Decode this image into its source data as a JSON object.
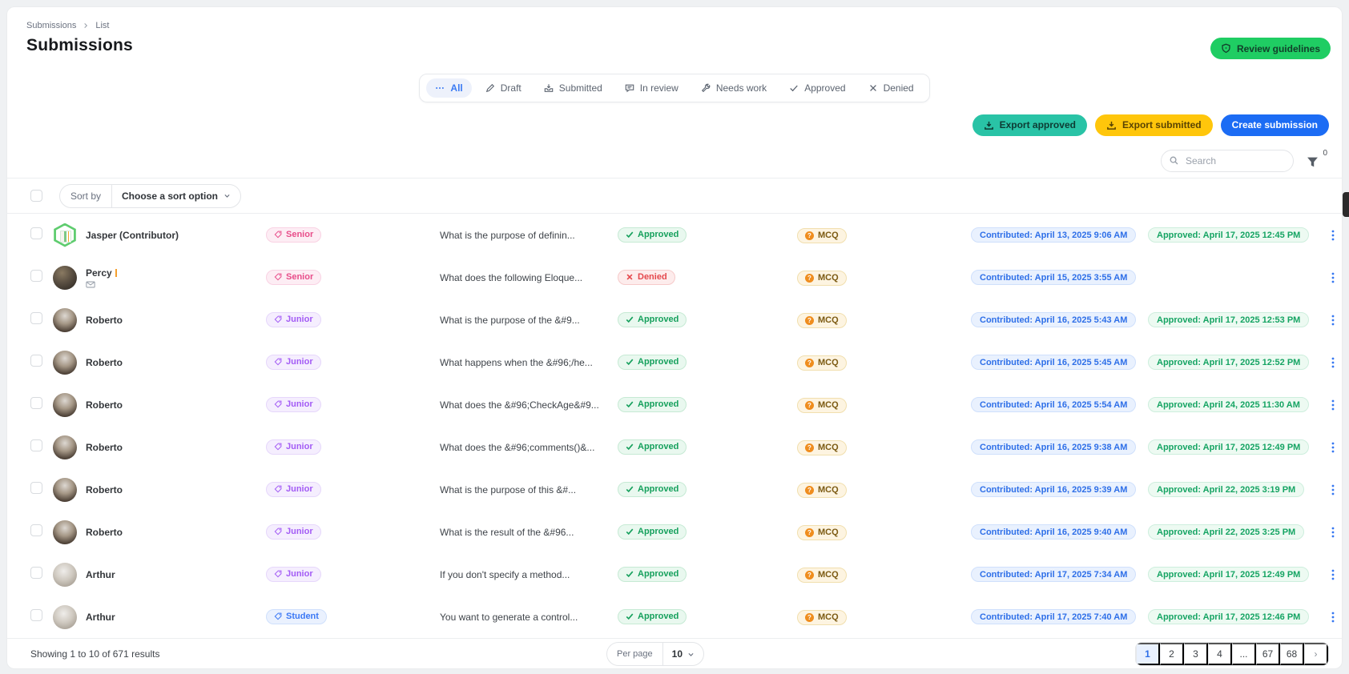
{
  "breadcrumb": {
    "items": [
      "Submissions",
      "List"
    ]
  },
  "page": {
    "title": "Submissions"
  },
  "header": {
    "review_button": "Review guidelines"
  },
  "tabs": {
    "items": [
      {
        "label": "All",
        "icon": "dots",
        "cls": "active"
      },
      {
        "label": "Draft",
        "icon": "pencil"
      },
      {
        "label": "Submitted",
        "icon": "inbox"
      },
      {
        "label": "In review",
        "icon": "chat"
      },
      {
        "label": "Needs work",
        "icon": "wrench"
      },
      {
        "label": "Approved",
        "icon": "check"
      },
      {
        "label": "Denied",
        "icon": "x"
      }
    ]
  },
  "toolbar": {
    "export_approved": "Export approved",
    "export_submitted": "Export submitted",
    "create_submission": "Create submission"
  },
  "search": {
    "placeholder": "Search",
    "filter_count": "0"
  },
  "sort": {
    "label": "Sort by",
    "value": "Choose a sort option"
  },
  "rows": [
    {
      "name": "Jasper (Contributor)",
      "avatar_class": "avatar-jasper",
      "level": "Senior",
      "level_class": "senior",
      "question": "What is the purpose of definin...",
      "status": "Approved",
      "status_class": "approved",
      "type": "MCQ",
      "contributed": "Contributed: April 13, 2025 9:06 AM",
      "approved": "Approved: April 17, 2025 12:45 PM"
    },
    {
      "name": "Percy",
      "marker": true,
      "envelope": true,
      "avatar_class": "avatar-percy",
      "level": "Senior",
      "level_class": "senior",
      "question": "What does the following Eloque...",
      "status": "Denied",
      "status_class": "denied",
      "type": "MCQ",
      "contributed": "Contributed: April 15, 2025 3:55 AM",
      "approved": null
    },
    {
      "name": "Roberto",
      "avatar_class": "avatar-roberto",
      "level": "Junior",
      "level_class": "junior",
      "question": "What is the purpose of the &#9...",
      "status": "Approved",
      "status_class": "approved",
      "type": "MCQ",
      "contributed": "Contributed: April 16, 2025 5:43 AM",
      "approved": "Approved: April 17, 2025 12:53 PM"
    },
    {
      "name": "Roberto",
      "avatar_class": "avatar-roberto",
      "level": "Junior",
      "level_class": "junior",
      "question": "What happens when the &#96;/he...",
      "status": "Approved",
      "status_class": "approved",
      "type": "MCQ",
      "contributed": "Contributed: April 16, 2025 5:45 AM",
      "approved": "Approved: April 17, 2025 12:52 PM"
    },
    {
      "name": "Roberto",
      "avatar_class": "avatar-roberto",
      "level": "Junior",
      "level_class": "junior",
      "question": "What does the &#96;CheckAge&#9...",
      "status": "Approved",
      "status_class": "approved",
      "type": "MCQ",
      "contributed": "Contributed: April 16, 2025 5:54 AM",
      "approved": "Approved: April 24, 2025 11:30 AM"
    },
    {
      "name": "Roberto",
      "avatar_class": "avatar-roberto",
      "level": "Junior",
      "level_class": "junior",
      "question": "What does the &#96;comments()&...",
      "status": "Approved",
      "status_class": "approved",
      "type": "MCQ",
      "contributed": "Contributed: April 16, 2025 9:38 AM",
      "approved": "Approved: April 17, 2025 12:49 PM"
    },
    {
      "name": "Roberto",
      "avatar_class": "avatar-roberto",
      "level": "Junior",
      "level_class": "junior",
      "question": "What is the purpose of this &#...",
      "status": "Approved",
      "status_class": "approved",
      "type": "MCQ",
      "contributed": "Contributed: April 16, 2025 9:39 AM",
      "approved": "Approved: April 22, 2025 3:19 PM"
    },
    {
      "name": "Roberto",
      "avatar_class": "avatar-roberto",
      "level": "Junior",
      "level_class": "junior",
      "question": "What is the result of the &#96...",
      "status": "Approved",
      "status_class": "approved",
      "type": "MCQ",
      "contributed": "Contributed: April 16, 2025 9:40 AM",
      "approved": "Approved: April 22, 2025 3:25 PM"
    },
    {
      "name": "Arthur",
      "avatar_class": "avatar-arthur",
      "level": "Junior",
      "level_class": "junior",
      "question": "If you don't specify a method...",
      "status": "Approved",
      "status_class": "approved",
      "type": "MCQ",
      "contributed": "Contributed: April 17, 2025 7:34 AM",
      "approved": "Approved: April 17, 2025 12:49 PM"
    },
    {
      "name": "Arthur",
      "avatar_class": "avatar-arthur",
      "level": "Student",
      "level_class": "student",
      "question": "You want to generate a control...",
      "status": "Approved",
      "status_class": "approved",
      "type": "MCQ",
      "contributed": "Contributed: April 17, 2025 7:40 AM",
      "approved": "Approved: April 17, 2025 12:46 PM"
    }
  ],
  "footer": {
    "showing": "Showing 1 to 10 of 671 results",
    "per_page_label": "Per page",
    "per_page_value": "10",
    "pages": [
      {
        "label": "1",
        "cls": "active"
      },
      {
        "label": "2"
      },
      {
        "label": "3"
      },
      {
        "label": "4"
      },
      {
        "label": "..."
      },
      {
        "label": "67"
      },
      {
        "label": "68"
      },
      {
        "label": "›",
        "cls": "next"
      }
    ]
  },
  "colors": {
    "accent_green": "#1fcd63",
    "accent_teal": "#29c3a6",
    "accent_amber": "#ffc60b",
    "accent_blue": "#1c6cf4",
    "link_blue": "#3577f1",
    "approved_green": "#15a05c",
    "denied_red": "#e5484d"
  }
}
